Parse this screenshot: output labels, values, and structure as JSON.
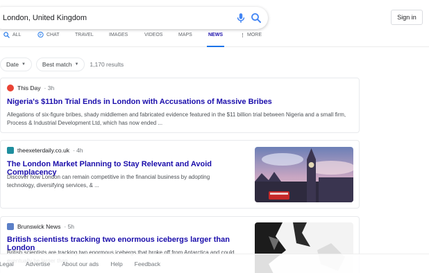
{
  "search": {
    "query": "London, United Kingdom"
  },
  "header": {
    "signin_label": "Sign in"
  },
  "tabs": [
    {
      "label": "ALL",
      "icon": "search-icon"
    },
    {
      "label": "CHAT",
      "icon": "chat-icon"
    },
    {
      "label": "TRAVEL"
    },
    {
      "label": "IMAGES"
    },
    {
      "label": "VIDEOS"
    },
    {
      "label": "MAPS"
    },
    {
      "label": "NEWS",
      "active": true
    },
    {
      "label": "MORE",
      "icon": "more-vert-icon"
    }
  ],
  "filters": {
    "date_label": "Date",
    "sort_label": "Best match",
    "result_count": "1,170 results"
  },
  "results": [
    {
      "source": "This Day",
      "age": "3h",
      "title": "Nigeria's $11bn Trial Ends in London with Accusations of Massive Bribes",
      "snippet": "Allegations of six-figure bribes, shady middlemen and fabricated evidence featured in the $11 billion trial between Nigeria and a small firm, Process & Industrial Development Ltd, which has now ended ..."
    },
    {
      "source": "theexeterdaily.co.uk",
      "age": "4h",
      "title": "The London Market Planning to Stay Relevant and Avoid Complacency",
      "snippet": "Discover how London can remain competitive in the financial business by adopting technology, diversifying services, & ..."
    },
    {
      "source": "Brunswick News",
      "age": "5h",
      "title": "British scientists tracking two enormous icebergs larger than London",
      "snippet": "British scientists are tracking two enormous icebergs that broke off from Antarctica and could eventually be larger than ..."
    }
  ],
  "footer": {
    "links": [
      "Legal",
      "Advertise",
      "About our ads",
      "Help",
      "Feedback"
    ]
  },
  "colors": {
    "link": "#1a0dab",
    "accent": "#1a73e8",
    "muted": "#70757a"
  }
}
